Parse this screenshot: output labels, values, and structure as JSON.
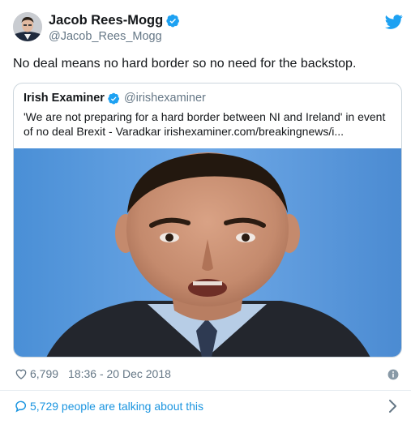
{
  "tweet": {
    "author": {
      "name": "Jacob Rees-Mogg",
      "handle": "@Jacob_Rees_Mogg",
      "verified": true
    },
    "text": "No deal means no hard border so no need for the backstop.",
    "quoted": {
      "name": "Irish Examiner",
      "handle": "@irishexaminer",
      "verified": true,
      "text": "'We are not preparing for a hard border between NI and Ireland' in event of no deal Brexit - Varadkar irishexaminer.com/breakingnews/i..."
    },
    "likes": "6,799",
    "timestamp": "18:36 - 20 Dec 2018",
    "talking": "5,729 people are talking about this"
  },
  "icons": {
    "brand": "twitter-bird-icon",
    "verified": "verified-badge-icon",
    "like": "heart-icon",
    "info": "info-icon",
    "conversation": "speech-bubble-icon",
    "more": "chevron-right-icon"
  },
  "colors": {
    "brand_blue": "#1da1f2",
    "link_blue": "#1b95e0",
    "secondary_text": "#657786",
    "primary_text": "#14171a",
    "border": "#ccd6dd"
  }
}
